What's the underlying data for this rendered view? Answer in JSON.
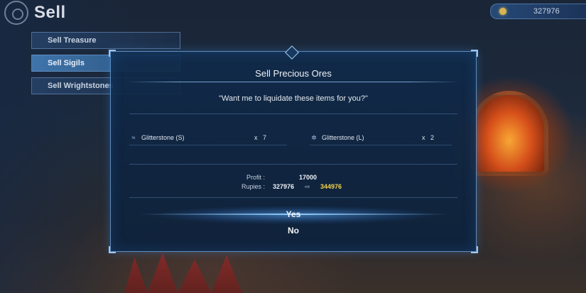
{
  "header": {
    "title": "Sell",
    "currency_value": "327976",
    "currency_icon": "rupie-coin-icon"
  },
  "sidebar": {
    "items": [
      {
        "label": "Sell Treasure",
        "active": false
      },
      {
        "label": "Sell Sigils",
        "active": true
      },
      {
        "label": "Sell Wrightstones",
        "active": false
      }
    ]
  },
  "dialog": {
    "title": "Sell Precious Ores",
    "question": "\"Want me to liquidate these items for you?\"",
    "items": [
      {
        "icon": "ore-small-icon",
        "name": "Glitterstone (S)",
        "qty_prefix": "x",
        "qty": "7"
      },
      {
        "icon": "ore-large-icon",
        "name": "Glitterstone (L)",
        "qty_prefix": "x",
        "qty": "2"
      }
    ],
    "profit_label": "Profit :",
    "profit_value": "17000",
    "rupies_label": "Rupies :",
    "rupies_current": "327976",
    "rupies_new": "344976",
    "yes_label": "Yes",
    "no_label": "No"
  },
  "colors": {
    "accent_blue": "#8cc0f0",
    "highlight_yellow": "#f2d54a",
    "panel_bg": "#102a4a"
  }
}
